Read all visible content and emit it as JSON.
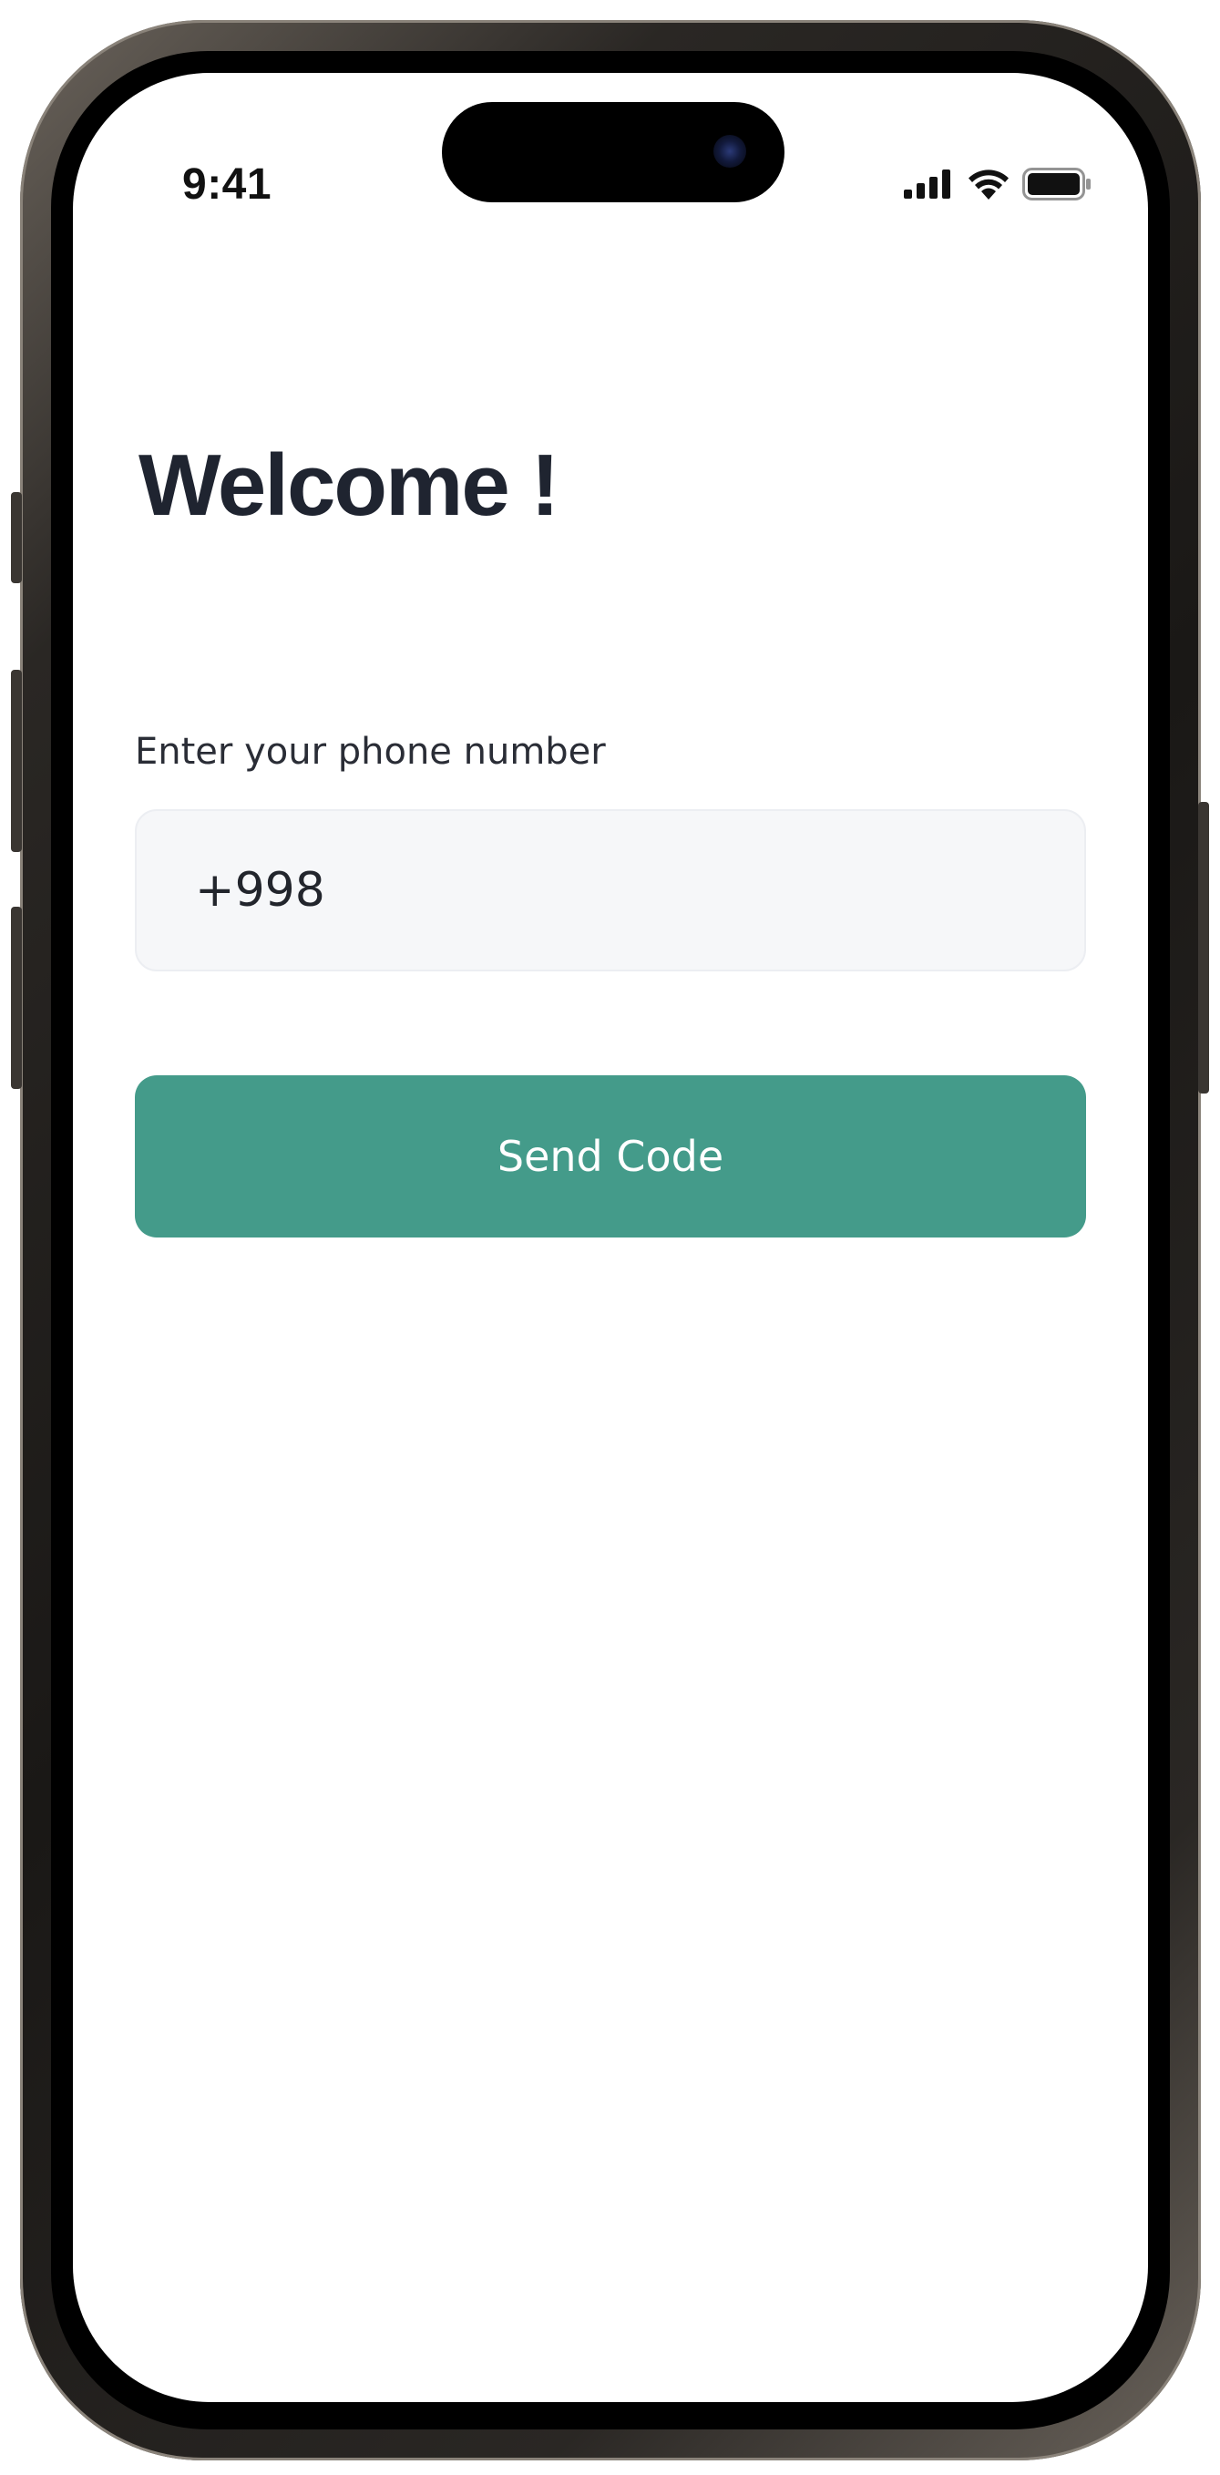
{
  "status_bar": {
    "time": "9:41",
    "icons": [
      "cellular-signal-icon",
      "wifi-icon",
      "battery-icon"
    ]
  },
  "login": {
    "title": "Welcome !",
    "phone_label": "Enter your phone number",
    "phone_value": "+998",
    "send_button_label": "Send Code"
  },
  "colors": {
    "accent": "#449b8a",
    "title_text": "#1f2430",
    "input_background": "#f6f7f9",
    "screen_background": "#ffffff"
  }
}
